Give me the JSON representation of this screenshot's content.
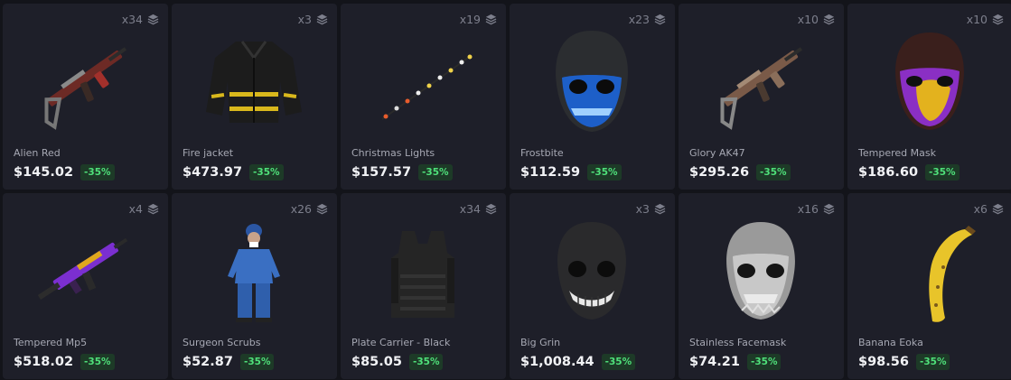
{
  "items": [
    {
      "name": "Alien Red",
      "price": "$145.02",
      "discount": "-35%",
      "qty": "x34",
      "art": "rifle-red"
    },
    {
      "name": "Fire jacket",
      "price": "$473.97",
      "discount": "-35%",
      "qty": "x3",
      "art": "jacket"
    },
    {
      "name": "Christmas Lights",
      "price": "$157.57",
      "discount": "-35%",
      "qty": "x19",
      "art": "lights"
    },
    {
      "name": "Frostbite",
      "price": "$112.59",
      "discount": "-35%",
      "qty": "x23",
      "art": "mask-frost"
    },
    {
      "name": "Glory AK47",
      "price": "$295.26",
      "discount": "-35%",
      "qty": "x10",
      "art": "rifle-glory"
    },
    {
      "name": "Tempered Mask",
      "price": "$186.60",
      "discount": "-35%",
      "qty": "x10",
      "art": "mask-tempered"
    },
    {
      "name": "Tempered Mp5",
      "price": "$518.02",
      "discount": "-35%",
      "qty": "x4",
      "art": "smg"
    },
    {
      "name": "Surgeon Scrubs",
      "price": "$52.87",
      "discount": "-35%",
      "qty": "x26",
      "art": "scrubs"
    },
    {
      "name": "Plate Carrier - Black",
      "price": "$85.05",
      "discount": "-35%",
      "qty": "x34",
      "art": "vest"
    },
    {
      "name": "Big Grin",
      "price": "$1,008.44",
      "discount": "-35%",
      "qty": "x3",
      "art": "mask-grin"
    },
    {
      "name": "Stainless Facemask",
      "price": "$74.21",
      "discount": "-35%",
      "qty": "x16",
      "art": "mask-stainless"
    },
    {
      "name": "Banana Eoka",
      "price": "$98.56",
      "discount": "-35%",
      "qty": "x6",
      "art": "banana"
    }
  ],
  "colors": {
    "background": "#13141a",
    "card": "#1e1f29",
    "discount_text": "#4fe07a",
    "discount_bg": "#1d3a27"
  }
}
